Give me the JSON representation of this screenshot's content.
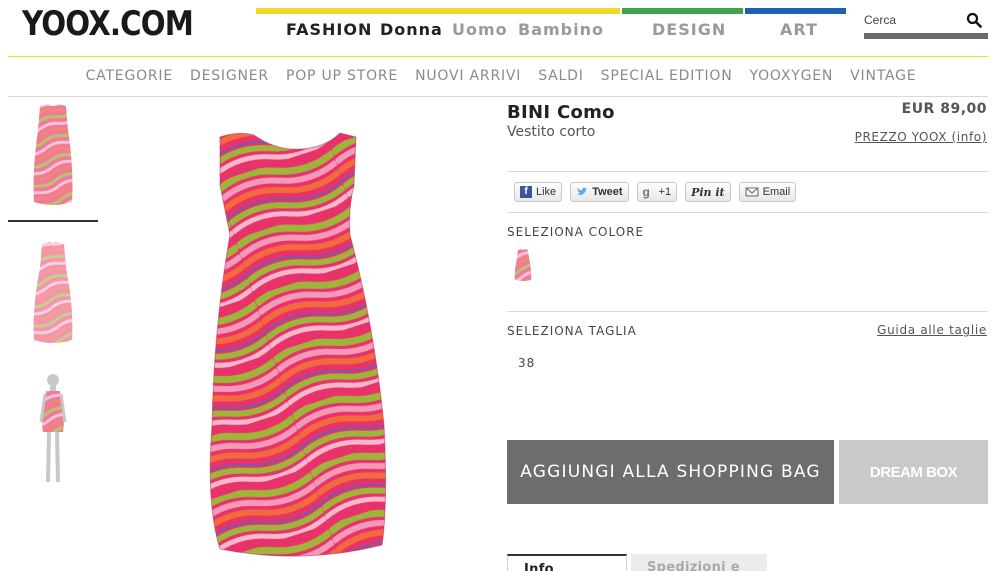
{
  "header": {
    "logo": "YOOX.COM",
    "nav": [
      {
        "label": "FASHION",
        "bar_color": "#f0d928",
        "text_color": "#222222"
      },
      {
        "label": "Donna",
        "text_color": "#222222"
      },
      {
        "label": "Uomo",
        "text_color": "#9a9a9a"
      },
      {
        "label": "Bambino",
        "text_color": "#9a9a9a"
      },
      {
        "label": "DESIGN",
        "bar_color": "#3aa648",
        "text_color": "#9a9a9a"
      },
      {
        "label": "ART",
        "bar_color": "#1f5fb5",
        "text_color": "#9a9a9a"
      }
    ],
    "search": {
      "placeholder": "Cerca",
      "value": "",
      "icon": "search-icon"
    }
  },
  "subnav": {
    "items": [
      "CATEGORIE",
      "DESIGNER",
      "POP UP STORE",
      "NUOVI ARRIVI",
      "SALDI",
      "SPECIAL EDITION",
      "YOOXYGEN",
      "VINTAGE"
    ]
  },
  "product": {
    "brand": "BINI Como",
    "subtitle": "Vestito corto",
    "price": "EUR 89,00",
    "price_link": "PREZZO YOOX (info)"
  },
  "social": {
    "like": "Like",
    "tweet": "Tweet",
    "plusone": "+1",
    "pinit": "Pin it",
    "email": "Email"
  },
  "color_section": {
    "label": "SELEZIONA COLORE"
  },
  "size_section": {
    "label": "SELEZIONA TAGLIA",
    "guide": "Guida alle taglie",
    "sizes": [
      "38"
    ]
  },
  "actions": {
    "add_to_bag": "AGGIUNGI ALLA SHOPPING BAG",
    "dream_box": "DREAM BOX"
  },
  "tabs": [
    "Info prodotto",
    "Spedizioni e resi"
  ],
  "colors": {
    "add_bag_bg": "#6d6d6d",
    "dream_box_bg": "#c9c9c9"
  }
}
